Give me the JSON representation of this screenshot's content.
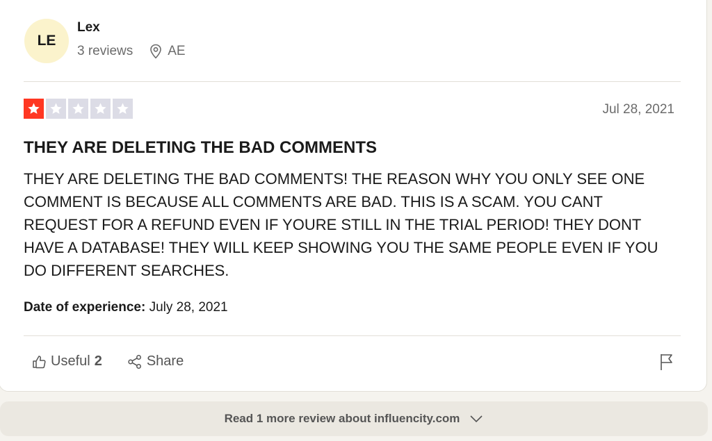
{
  "consumer": {
    "initials": "LE",
    "name": "Lex",
    "reviews_count": "3 reviews",
    "country": "AE",
    "avatar_color": "#fbf3cc"
  },
  "review": {
    "rating": 1,
    "max_rating": 5,
    "rating_color": "#ff3722",
    "date": "Jul 28, 2021",
    "title": "THEY ARE DELETING THE BAD COMMENTS",
    "body": "THEY ARE DELETING THE BAD COMMENTS! THE REASON WHY YOU ONLY SEE ONE COMMENT IS BECAUSE ALL COMMENTS ARE BAD. THIS IS A SCAM. YOU CANT REQUEST FOR A REFUND EVEN IF YOURE STILL IN THE TRIAL PERIOD! THEY DONT HAVE A DATABASE! THEY WILL KEEP SHOWING YOU THE SAME PEOPLE EVEN IF YOU DO DIFFERENT SEARCHES.",
    "experience_label": "Date of experience:",
    "experience_date": "July 28, 2021"
  },
  "actions": {
    "useful_label": "Useful",
    "useful_count": "2",
    "share_label": "Share"
  },
  "footer": {
    "more_label": "Read 1 more review about influencity.com"
  },
  "icons": {
    "location": "location-pin-icon",
    "star": "star-icon",
    "useful": "thumbs-up-icon",
    "share": "share-icon",
    "flag": "flag-icon",
    "more": "chevron-down-icon"
  }
}
